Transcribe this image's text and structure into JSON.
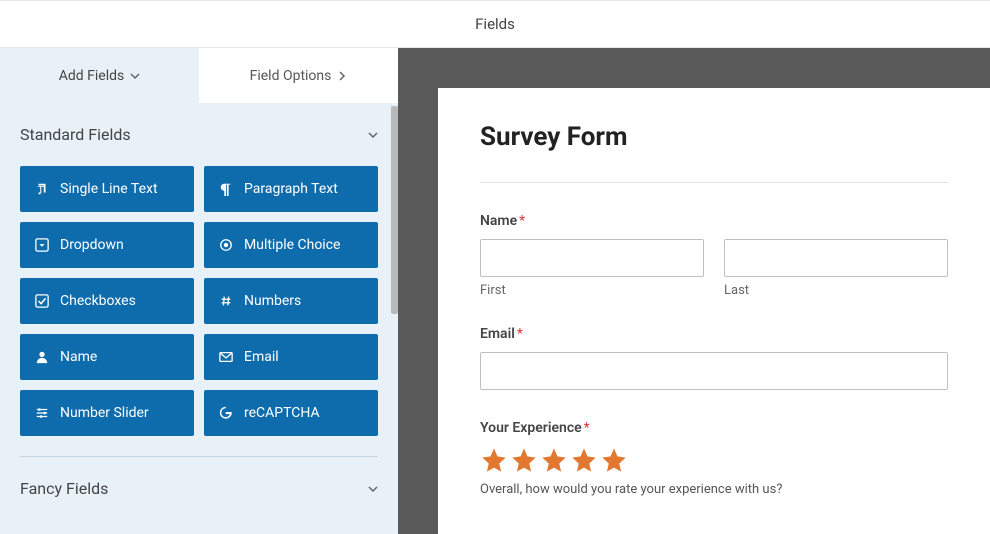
{
  "header": {
    "title": "Fields"
  },
  "tabs": {
    "add_label": "Add Fields",
    "options_label": "Field Options"
  },
  "sections": {
    "standard": {
      "title": "Standard Fields",
      "items": [
        "Single Line Text",
        "Paragraph Text",
        "Dropdown",
        "Multiple Choice",
        "Checkboxes",
        "Numbers",
        "Name",
        "Email",
        "Number Slider",
        "reCAPTCHA"
      ]
    },
    "fancy": {
      "title": "Fancy Fields"
    }
  },
  "form": {
    "title": "Survey Form",
    "name": {
      "label": "Name",
      "required": "*",
      "first_sub": "First",
      "last_sub": "Last"
    },
    "email": {
      "label": "Email",
      "required": "*"
    },
    "experience": {
      "label": "Your Experience",
      "required": "*",
      "description": "Overall, how would you rate your experience with us?"
    }
  }
}
